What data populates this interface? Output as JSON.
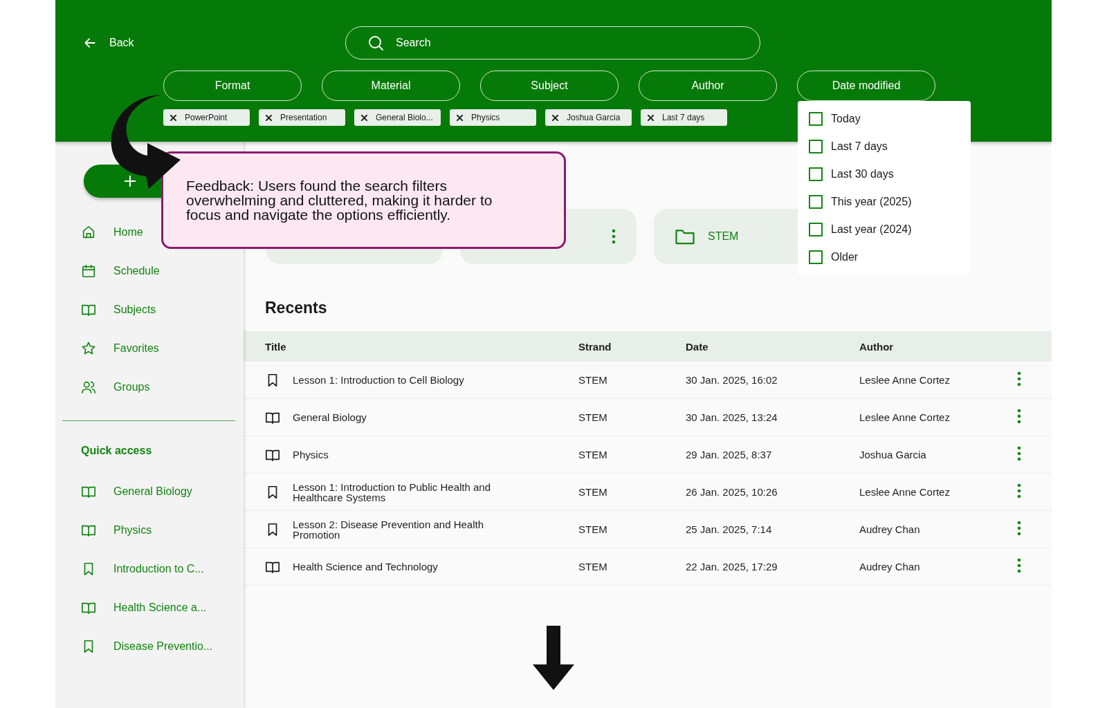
{
  "header": {
    "back": "Back",
    "search": {
      "placeholder": "Search"
    }
  },
  "filters": [
    {
      "label": "Format"
    },
    {
      "label": "Material"
    },
    {
      "label": "Subject"
    },
    {
      "label": "Author"
    },
    {
      "label": "Date modified"
    }
  ],
  "chips": [
    "PowerPoint",
    "Presentation",
    "General Biolo...",
    "Physics",
    "Joshua Garcia",
    "Last 7 days"
  ],
  "date_menu": {
    "options": [
      {
        "label": "Today",
        "checked": false
      },
      {
        "label": "Last 7 days",
        "checked": false
      },
      {
        "label": "Last 30 days",
        "checked": false
      },
      {
        "label": "This year (2025)",
        "checked": false
      },
      {
        "label": "Last year (2024)",
        "checked": false
      },
      {
        "label": "Older",
        "checked": false
      }
    ]
  },
  "sidebar": {
    "nav": [
      "Home",
      "Schedule",
      "Subjects",
      "Favorites",
      "Groups"
    ],
    "quick_access": {
      "title": "Quick access",
      "items": [
        {
          "label": "General Biology",
          "kind": "subject"
        },
        {
          "label": "Physics",
          "kind": "subject"
        },
        {
          "label": "Introduction to C...",
          "kind": "lesson"
        },
        {
          "label": "Health Science a...",
          "kind": "subject"
        },
        {
          "label": "Disease Preventio...",
          "kind": "lesson"
        }
      ]
    }
  },
  "folder_cards": [
    {
      "kind": "blank"
    },
    {
      "kind": "blank",
      "menu": true
    },
    {
      "kind": "folder",
      "label": "STEM"
    }
  ],
  "recents": {
    "title": "Recents",
    "columns": [
      "Title",
      "Strand",
      "Date",
      "Author"
    ],
    "rows": [
      {
        "kind": "lesson",
        "title": "Lesson 1: Introduction to Cell Biology",
        "strand": "STEM",
        "date": "30 Jan. 2025, 16:02",
        "author": "Leslee Anne Cortez"
      },
      {
        "kind": "subject",
        "title": "General Biology",
        "strand": "STEM",
        "date": "30 Jan. 2025, 13:24",
        "author": "Leslee Anne Cortez"
      },
      {
        "kind": "subject",
        "title": "Physics",
        "strand": "STEM",
        "date": "29 Jan. 2025, 8:37",
        "author": "Joshua Garcia"
      },
      {
        "kind": "lesson",
        "title": "Lesson 1: Introduction to Public Health and Healthcare Systems",
        "strand": "STEM",
        "date": "26 Jan. 2025, 10:26",
        "author": "Leslee Anne Cortez"
      },
      {
        "kind": "lesson",
        "title": "Lesson 2: Disease Prevention and Health Promotion",
        "strand": "STEM",
        "date": "25 Jan. 2025, 7:14",
        "author": "Audrey Chan"
      },
      {
        "kind": "subject",
        "title": "Health Science and Technology",
        "strand": "STEM",
        "date": "22 Jan. 2025, 17:29",
        "author": "Audrey Chan"
      }
    ]
  },
  "annotation": {
    "text": "Feedback: Users found the search filters overwhelming and cluttered, making it harder to focus and navigate the options efficiently."
  }
}
